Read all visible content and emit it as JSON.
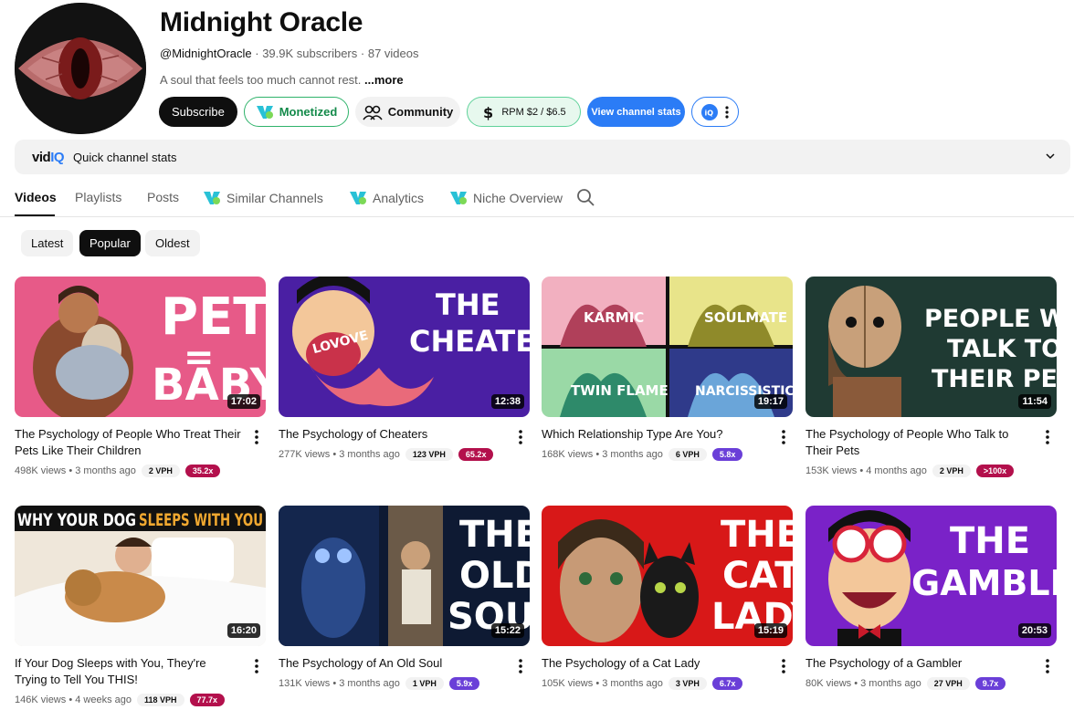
{
  "channel": {
    "name": "Midnight Oracle",
    "handle": "@MidnightOracle",
    "subscribers": "39.9K subscribers",
    "videos": "87 videos",
    "description": "A soul that feels too much cannot rest.",
    "more_label": "...more"
  },
  "buttons": {
    "subscribe": "Subscribe",
    "monetized": "Monetized",
    "community": "Community",
    "rpm": "RPM $2 / $6.5",
    "view_stats": "View channel stats"
  },
  "quickbar": {
    "brand": "vidIQ",
    "label": "Quick channel stats"
  },
  "tabs": [
    {
      "label": "Videos"
    },
    {
      "label": "Playlists"
    },
    {
      "label": "Posts"
    },
    {
      "label": "Similar Channels"
    },
    {
      "label": "Analytics"
    },
    {
      "label": "Niche Overview"
    }
  ],
  "chips": [
    {
      "label": "Latest"
    },
    {
      "label": "Popular"
    },
    {
      "label": "Oldest"
    }
  ],
  "videos": [
    {
      "title": "The Psychology of People Who Treat Their Pets Like Their Children",
      "views": "498K views",
      "age": "3 months ago",
      "vph": "2 VPH",
      "mult": "35.2x",
      "mult_color": "#b3104c",
      "duration": "17:02",
      "thumb_text": [
        "PET",
        "=",
        "BABY"
      ]
    },
    {
      "title": "The Psychology of Cheaters",
      "views": "277K views",
      "age": "3 months ago",
      "vph": "123 VPH",
      "mult": "65.2x",
      "mult_color": "#b3104c",
      "duration": "12:38",
      "thumb_text": [
        "THE",
        "CHEATER",
        "LOVOVE"
      ]
    },
    {
      "title": "Which Relationship Type Are You?",
      "views": "168K views",
      "age": "3 months ago",
      "vph": "6 VPH",
      "mult": "5.8x",
      "mult_color": "#6a3fd8",
      "duration": "19:17",
      "thumb_text": [
        "KARMIC",
        "SOULMATE",
        "TWIN FLAME",
        "NARCISSISTIC"
      ]
    },
    {
      "title": "The Psychology of People Who Talk to Their Pets",
      "views": "153K views",
      "age": "4 months ago",
      "vph": "2 VPH",
      "mult": ">100x",
      "mult_color": "#b3104c",
      "duration": "11:54",
      "thumb_text": [
        "PEOPLE WHO",
        "TALK TO",
        "THEIR PETS"
      ]
    },
    {
      "title": "If Your Dog Sleeps with You, They're Trying to Tell You THIS!",
      "views": "146K views",
      "age": "4 weeks ago",
      "vph": "118 VPH",
      "mult": "77.7x",
      "mult_color": "#b3104c",
      "duration": "16:20",
      "thumb_text": [
        "WHY YOUR DOG",
        "SLEEPS WITH YOU"
      ]
    },
    {
      "title": "The Psychology of An Old Soul",
      "views": "131K views",
      "age": "3 months ago",
      "vph": "1 VPH",
      "mult": "5.9x",
      "mult_color": "#6a3fd8",
      "duration": "15:22",
      "thumb_text": [
        "THE",
        "OLD",
        "SOUL"
      ]
    },
    {
      "title": "The Psychology of a Cat Lady",
      "views": "105K views",
      "age": "3 months ago",
      "vph": "3 VPH",
      "mult": "6.7x",
      "mult_color": "#6a3fd8",
      "duration": "15:19",
      "thumb_text": [
        "THE",
        "CAT",
        "LADY"
      ]
    },
    {
      "title": "The Psychology of a Gambler",
      "views": "80K views",
      "age": "3 months ago",
      "vph": "27 VPH",
      "mult": "9.7x",
      "mult_color": "#6a3fd8",
      "duration": "20:53",
      "thumb_text": [
        "THE",
        "GAMBLER"
      ]
    }
  ]
}
